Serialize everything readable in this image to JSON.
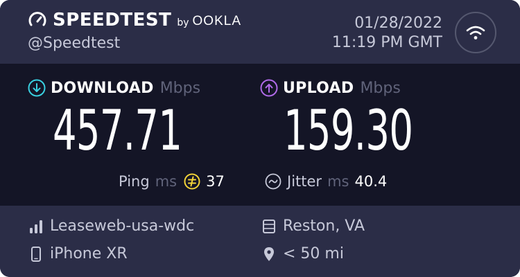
{
  "header": {
    "brand": "SPEEDTEST",
    "by": "by",
    "ookla": "OOKLA",
    "handle": "@Speedtest",
    "date": "01/28/2022",
    "time": "11:19 PM GMT"
  },
  "download": {
    "label": "DOWNLOAD",
    "unit": "Mbps",
    "value": "457.71",
    "icon": "arrow-down-circle-icon",
    "color": "#39d0e0"
  },
  "upload": {
    "label": "UPLOAD",
    "unit": "Mbps",
    "value": "159.30",
    "icon": "arrow-up-circle-icon",
    "color": "#b06ae8"
  },
  "ping": {
    "label": "Ping",
    "unit": "ms",
    "value": "37",
    "icon": "ping-icon",
    "color": "#f2d338"
  },
  "jitter": {
    "label": "Jitter",
    "unit": "ms",
    "value": "40.4",
    "icon": "jitter-icon"
  },
  "footer": {
    "server": "Leaseweb-usa-wdc",
    "device": "iPhone XR",
    "location": "Reston, VA",
    "distance": "< 50 mi"
  },
  "colors": {
    "header_bg": "#2b2d47",
    "main_bg": "#141526",
    "muted": "#60637a",
    "text_soft": "#c7c9d9"
  }
}
